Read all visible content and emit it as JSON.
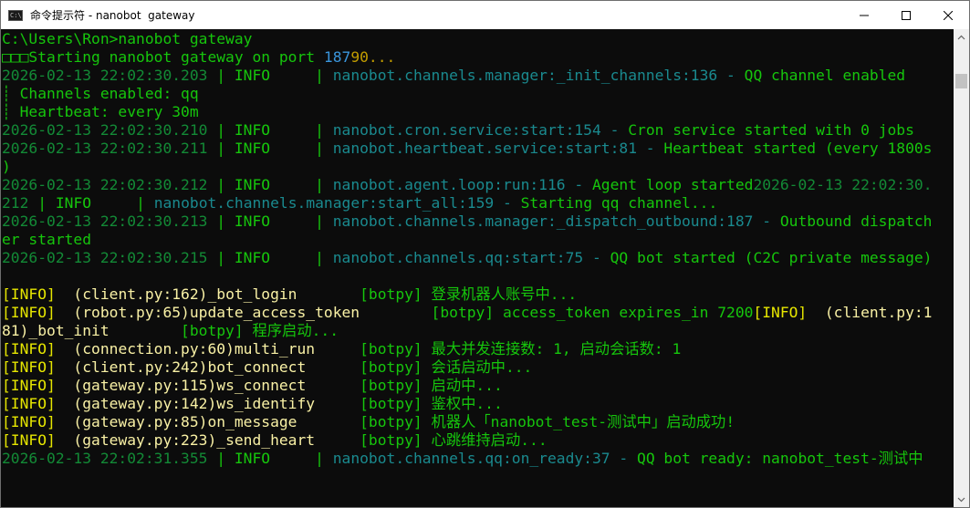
{
  "window": {
    "title": "命令提示符 - nanobot  gateway",
    "app_icon_text": "C:\\",
    "controls": {
      "minimize": "minimize-icon",
      "maximize": "maximize-icon",
      "close": "close-icon"
    }
  },
  "colors": {
    "console_bg": "#0c0c0c",
    "green": "#16c60c",
    "dark_green": "#138a36",
    "cyan": "#3a96dd",
    "yellow": "#f9f1a5"
  },
  "console": {
    "lines": [
      {
        "segments": [
          {
            "t": "C:\\Users\\Ron>nanobot gateway",
            "c": "g"
          }
        ]
      },
      {
        "segments": [
          {
            "t": "□□□Starting nanobot gateway on port ",
            "c": "g"
          },
          {
            "t": "187",
            "c": "c"
          },
          {
            "t": "90...",
            "c": "dy"
          }
        ]
      },
      {
        "segments": [
          {
            "t": "2026-02-13 22:02:30.203",
            "c": "dg"
          },
          {
            "t": " | ",
            "c": "g"
          },
          {
            "t": "INFO    ",
            "c": "g"
          },
          {
            "t": " | ",
            "c": "g"
          },
          {
            "t": "nanobot.channels.manager:_init_channels:136",
            "c": "dc"
          },
          {
            "t": " - ",
            "c": "dc"
          },
          {
            "t": "QQ channel enabled",
            "c": "g"
          }
        ]
      },
      {
        "segments": [
          {
            "t": "┊ Channels enabled: qq",
            "c": "g"
          }
        ]
      },
      {
        "segments": [
          {
            "t": "┊ Heartbeat: every 30m",
            "c": "g"
          }
        ]
      },
      {
        "segments": [
          {
            "t": "2026-02-13 22:02:30.210",
            "c": "dg"
          },
          {
            "t": " | ",
            "c": "g"
          },
          {
            "t": "INFO    ",
            "c": "g"
          },
          {
            "t": " | ",
            "c": "g"
          },
          {
            "t": "nanobot.cron.service:start:154",
            "c": "dc"
          },
          {
            "t": " - ",
            "c": "dc"
          },
          {
            "t": "Cron service started with 0 jobs",
            "c": "g"
          }
        ]
      },
      {
        "segments": [
          {
            "t": "2026-02-13 22:02:30.211",
            "c": "dg"
          },
          {
            "t": " | ",
            "c": "g"
          },
          {
            "t": "INFO    ",
            "c": "g"
          },
          {
            "t": " | ",
            "c": "g"
          },
          {
            "t": "nanobot.heartbeat.service:start:81",
            "c": "dc"
          },
          {
            "t": " - ",
            "c": "dc"
          },
          {
            "t": "Heartbeat started (every 1800s",
            "c": "g"
          }
        ]
      },
      {
        "segments": [
          {
            "t": ")",
            "c": "g"
          }
        ]
      },
      {
        "segments": [
          {
            "t": "2026-02-13 22:02:30.212",
            "c": "dg"
          },
          {
            "t": " | ",
            "c": "g"
          },
          {
            "t": "INFO    ",
            "c": "g"
          },
          {
            "t": " | ",
            "c": "g"
          },
          {
            "t": "nanobot.agent.loop:run:116",
            "c": "dc"
          },
          {
            "t": " - ",
            "c": "dc"
          },
          {
            "t": "Agent loop started",
            "c": "g"
          },
          {
            "t": "2026-02-13 22:02:30.",
            "c": "dg"
          }
        ]
      },
      {
        "segments": [
          {
            "t": "212",
            "c": "dg"
          },
          {
            "t": " | ",
            "c": "g"
          },
          {
            "t": "INFO    ",
            "c": "g"
          },
          {
            "t": " | ",
            "c": "g"
          },
          {
            "t": "nanobot.channels.manager:start_all:159",
            "c": "dc"
          },
          {
            "t": " - ",
            "c": "dc"
          },
          {
            "t": "Starting qq channel...",
            "c": "g"
          }
        ]
      },
      {
        "segments": [
          {
            "t": "2026-02-13 22:02:30.213",
            "c": "dg"
          },
          {
            "t": " | ",
            "c": "g"
          },
          {
            "t": "INFO    ",
            "c": "g"
          },
          {
            "t": " | ",
            "c": "g"
          },
          {
            "t": "nanobot.channels.manager:_dispatch_outbound:187",
            "c": "dc"
          },
          {
            "t": " - ",
            "c": "dc"
          },
          {
            "t": "Outbound dispatch",
            "c": "g"
          }
        ]
      },
      {
        "segments": [
          {
            "t": "er started",
            "c": "g"
          }
        ]
      },
      {
        "segments": [
          {
            "t": "2026-02-13 22:02:30.215",
            "c": "dg"
          },
          {
            "t": " | ",
            "c": "g"
          },
          {
            "t": "INFO    ",
            "c": "g"
          },
          {
            "t": " | ",
            "c": "g"
          },
          {
            "t": "nanobot.channels.qq:start:75",
            "c": "dc"
          },
          {
            "t": " - ",
            "c": "dc"
          },
          {
            "t": "QQ bot started (C2C private message)",
            "c": "g"
          }
        ]
      },
      {
        "segments": [
          {
            "t": "",
            "c": "g"
          }
        ]
      },
      {
        "segments": [
          {
            "t": "[INFO]",
            "c": "y2"
          },
          {
            "t": "  (client.py:162)_bot_login       ",
            "c": "y"
          },
          {
            "t": "[botpy]",
            "c": "g"
          },
          {
            "t": " 登录机器人账号中...",
            "c": "g"
          }
        ]
      },
      {
        "segments": [
          {
            "t": "[INFO]",
            "c": "y2"
          },
          {
            "t": "  (robot.py:65)update_access_token        ",
            "c": "y"
          },
          {
            "t": "[botpy]",
            "c": "g"
          },
          {
            "t": " access_token expires_in 7200",
            "c": "g"
          },
          {
            "t": "[INFO]",
            "c": "y2"
          },
          {
            "t": "  (client.py:1",
            "c": "y"
          }
        ]
      },
      {
        "segments": [
          {
            "t": "81)_bot_init        ",
            "c": "y"
          },
          {
            "t": "[botpy]",
            "c": "g"
          },
          {
            "t": " 程序启动...",
            "c": "g"
          }
        ]
      },
      {
        "segments": [
          {
            "t": "[INFO]",
            "c": "y2"
          },
          {
            "t": "  (connection.py:60)multi_run     ",
            "c": "y"
          },
          {
            "t": "[botpy]",
            "c": "g"
          },
          {
            "t": " 最大并发连接数: 1, 启动会话数: 1",
            "c": "g"
          }
        ]
      },
      {
        "segments": [
          {
            "t": "[INFO]",
            "c": "y2"
          },
          {
            "t": "  (client.py:242)bot_connect      ",
            "c": "y"
          },
          {
            "t": "[botpy]",
            "c": "g"
          },
          {
            "t": " 会话启动中...",
            "c": "g"
          }
        ]
      },
      {
        "segments": [
          {
            "t": "[INFO]",
            "c": "y2"
          },
          {
            "t": "  (gateway.py:115)ws_connect      ",
            "c": "y"
          },
          {
            "t": "[botpy]",
            "c": "g"
          },
          {
            "t": " 启动中...",
            "c": "g"
          }
        ]
      },
      {
        "segments": [
          {
            "t": "[INFO]",
            "c": "y2"
          },
          {
            "t": "  (gateway.py:142)ws_identify     ",
            "c": "y"
          },
          {
            "t": "[botpy]",
            "c": "g"
          },
          {
            "t": " 鉴权中...",
            "c": "g"
          }
        ]
      },
      {
        "segments": [
          {
            "t": "[INFO]",
            "c": "y2"
          },
          {
            "t": "  (gateway.py:85)on_message       ",
            "c": "y"
          },
          {
            "t": "[botpy]",
            "c": "g"
          },
          {
            "t": " 机器人「nanobot_test-测试中」启动成功!",
            "c": "g"
          }
        ]
      },
      {
        "segments": [
          {
            "t": "[INFO]",
            "c": "y2"
          },
          {
            "t": "  (gateway.py:223)_send_heart     ",
            "c": "y"
          },
          {
            "t": "[botpy]",
            "c": "g"
          },
          {
            "t": " 心跳维持启动...",
            "c": "g"
          }
        ]
      },
      {
        "segments": [
          {
            "t": "2026-02-13 22:02:31.355",
            "c": "dg"
          },
          {
            "t": " | ",
            "c": "g"
          },
          {
            "t": "INFO    ",
            "c": "g"
          },
          {
            "t": " | ",
            "c": "g"
          },
          {
            "t": "nanobot.channels.qq:on_ready:37",
            "c": "dc"
          },
          {
            "t": " - ",
            "c": "dc"
          },
          {
            "t": "QQ bot ready: nanobot_test-测试中",
            "c": "g"
          }
        ]
      }
    ]
  }
}
